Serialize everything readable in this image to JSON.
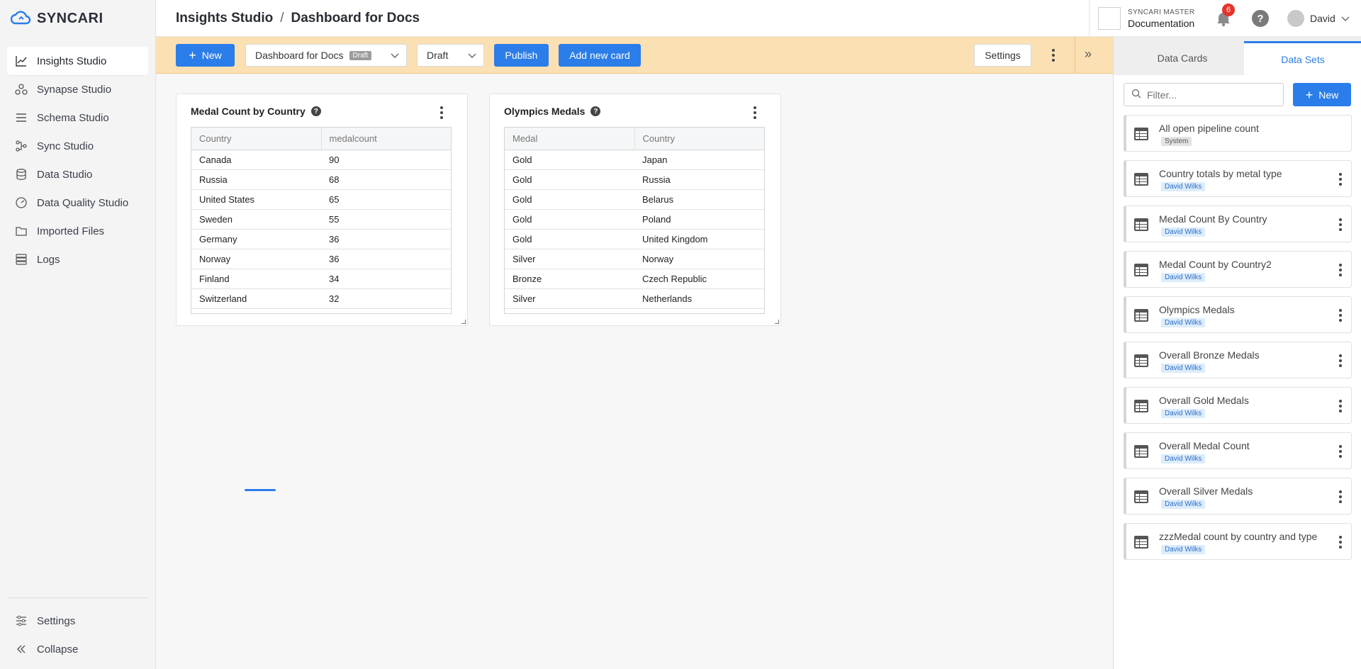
{
  "brand": {
    "name": "SYNCARI"
  },
  "sidebar": {
    "items": [
      {
        "label": "Insights Studio",
        "icon": "chart-icon",
        "active": true
      },
      {
        "label": "Synapse Studio",
        "icon": "synapse-icon"
      },
      {
        "label": "Schema Studio",
        "icon": "schema-icon"
      },
      {
        "label": "Sync Studio",
        "icon": "sync-icon"
      },
      {
        "label": "Data Studio",
        "icon": "database-icon"
      },
      {
        "label": "Data Quality Studio",
        "icon": "gauge-icon"
      },
      {
        "label": "Imported Files",
        "icon": "folder-icon"
      },
      {
        "label": "Logs",
        "icon": "logs-icon"
      }
    ],
    "bottom": [
      {
        "label": "Settings",
        "icon": "sliders-icon"
      },
      {
        "label": "Collapse",
        "icon": "double-chevron-left-icon"
      }
    ]
  },
  "header": {
    "breadcrumb": [
      "Insights Studio",
      "Dashboard for Docs"
    ],
    "separator": "/",
    "tenant_label": "SYNCARI MASTER",
    "tenant_name": "Documentation",
    "notification_count": "6",
    "help": "?",
    "user": "David"
  },
  "toolbar": {
    "new_label": "New",
    "dashboard_select": "Dashboard for Docs",
    "dashboard_chip": "Draft",
    "status_select": "Draft",
    "publish_label": "Publish",
    "add_card_label": "Add new card",
    "settings_label": "Settings",
    "expand_glyph": "»"
  },
  "cards": [
    {
      "title": "Medal Count by Country",
      "columns": [
        "Country",
        "medalcount"
      ],
      "rows": [
        [
          "Canada",
          "90"
        ],
        [
          "Russia",
          "68"
        ],
        [
          "United States",
          "65"
        ],
        [
          "Sweden",
          "55"
        ],
        [
          "Germany",
          "36"
        ],
        [
          "Norway",
          "36"
        ],
        [
          "Finland",
          "34"
        ],
        [
          "Switzerland",
          "32"
        ]
      ]
    },
    {
      "title": "Olympics Medals",
      "columns": [
        "Medal",
        "Country"
      ],
      "rows": [
        [
          "Gold",
          "Japan"
        ],
        [
          "Gold",
          "Russia"
        ],
        [
          "Gold",
          "Belarus"
        ],
        [
          "Gold",
          "Poland"
        ],
        [
          "Gold",
          "United Kingdom"
        ],
        [
          "Silver",
          "Norway"
        ],
        [
          "Bronze",
          "Czech Republic"
        ],
        [
          "Silver",
          "Netherlands"
        ]
      ]
    }
  ],
  "right_panel": {
    "tabs": [
      "Data Cards",
      "Data Sets"
    ],
    "active_tab": "Data Sets",
    "filter_placeholder": "Filter...",
    "new_label": "New",
    "datasets": [
      {
        "name": "All open pipeline count",
        "owner": "System",
        "system": true
      },
      {
        "name": "Country totals by metal type",
        "owner": "David Wilks"
      },
      {
        "name": "Medal Count By Country",
        "owner": "David Wilks"
      },
      {
        "name": "Medal Count by Country2",
        "owner": "David Wilks"
      },
      {
        "name": "Olympics Medals",
        "owner": "David Wilks"
      },
      {
        "name": "Overall Bronze Medals",
        "owner": "David Wilks"
      },
      {
        "name": "Overall Gold Medals",
        "owner": "David Wilks"
      },
      {
        "name": "Overall Medal Count",
        "owner": "David Wilks"
      },
      {
        "name": "Overall Silver Medals",
        "owner": "David Wilks"
      },
      {
        "name": "zzzMedal count by country and type",
        "owner": "David Wilks"
      }
    ]
  },
  "colors": {
    "accent": "#2b7de9",
    "toolbar_bg": "#fbe0b3",
    "badge": "#e5342b"
  }
}
